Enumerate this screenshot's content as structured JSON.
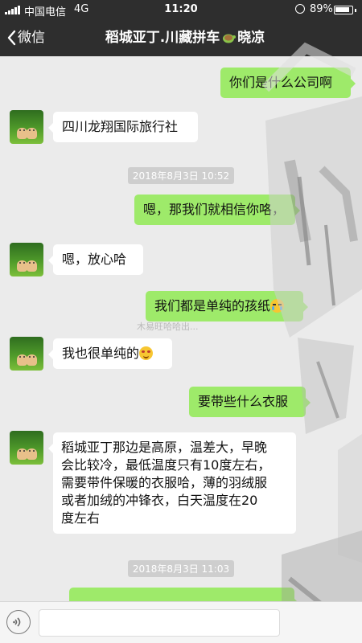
{
  "status": {
    "carrier": "中国电信",
    "network": "4G",
    "time": "11:20",
    "battery_text": "89%",
    "battery_level": 0.89
  },
  "nav": {
    "back_label": "微信",
    "title_part1": "稻城亚丁.川藏拼车",
    "title_part2": "晓凉",
    "title_icon": "turtle-icon"
  },
  "messages": [
    {
      "side": "right",
      "text": "你们是什么公司啊"
    },
    {
      "side": "left",
      "text": "四川龙翔国际旅行社"
    },
    {
      "type": "timestamp",
      "text": "2018年8月3日 10:52"
    },
    {
      "side": "right",
      "text": "嗯，那我们就相信你咯，"
    },
    {
      "side": "left",
      "text": "嗯，放心哈"
    },
    {
      "side": "right",
      "text": "我们都是单纯的孩纸",
      "emoji": "crying-face"
    },
    {
      "side": "left",
      "text": "我也很单纯的",
      "emoji": "smiling-face"
    },
    {
      "side": "right",
      "text": "要带些什么衣服"
    },
    {
      "side": "left",
      "lines": [
        "稻城亚丁那边是高原，温差大，早晚",
        "会比较冷，最低温度只有10度左右，",
        "需要带件保暖的衣服哈，薄的羽绒服",
        "或者加绒的冲锋衣，白天温度在20",
        "度左右"
      ]
    },
    {
      "type": "timestamp",
      "text": "2018年8月3日 11:03"
    }
  ],
  "watermark": "木易旺哈哈出...",
  "colors": {
    "header_bg": "#2e2e2e",
    "chat_bg": "#ebebeb",
    "sent_bubble": "#9eea6a",
    "received_bubble": "#ffffff",
    "timestamp_bg": "#cecece"
  },
  "input": {
    "voice_icon": "voice-icon",
    "placeholder": ""
  }
}
